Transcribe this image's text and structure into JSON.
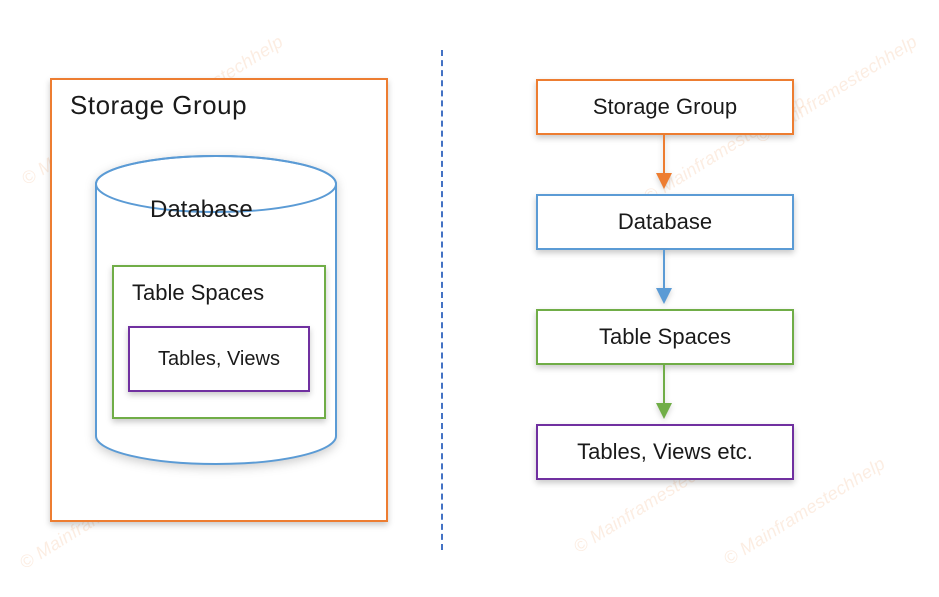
{
  "watermark_text": "© Mainframestechhelp",
  "colors": {
    "orange": "#ed7d31",
    "blue": "#5b9bd5",
    "green": "#70ad47",
    "purple": "#7030a0"
  },
  "left": {
    "storage_group": "Storage Group",
    "database": "Database",
    "tablespaces": "Table Spaces",
    "tables_views": "Tables, Views"
  },
  "right": {
    "nodes": [
      {
        "label": "Storage Group",
        "color": "#ed7d31"
      },
      {
        "label": "Database",
        "color": "#5b9bd5"
      },
      {
        "label": "Table Spaces",
        "color": "#70ad47"
      },
      {
        "label": "Tables, Views etc.",
        "color": "#7030a0"
      }
    ]
  }
}
